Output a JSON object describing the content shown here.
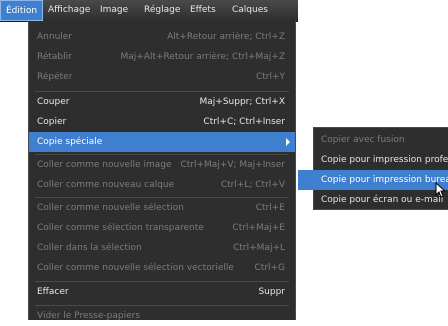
{
  "menubar": {
    "items": [
      "Édition",
      "Affichage",
      "Image",
      "Réglage",
      "Effets",
      "Calques"
    ]
  },
  "menu": {
    "items": [
      {
        "label": "Annuler",
        "shortcut": "Alt+Retour arrière; Ctrl+Z",
        "disabled": true
      },
      {
        "label": "Rétablir",
        "shortcut": "Maj+Alt+Retour arrière; Ctrl+Maj+Z",
        "disabled": true
      },
      {
        "label": "Répéter",
        "shortcut": "Ctrl+Y",
        "disabled": true
      },
      {
        "label": "Couper",
        "shortcut": "Maj+Suppr; Ctrl+X",
        "disabled": false
      },
      {
        "label": "Copier",
        "shortcut": "Ctrl+C; Ctrl+Inser",
        "disabled": false
      },
      {
        "label": "Copie spéciale",
        "shortcut": "",
        "disabled": false
      },
      {
        "label": "Coller comme nouvelle image",
        "shortcut": "Ctrl+Maj+V; Maj+Inser",
        "disabled": true
      },
      {
        "label": "Coller comme nouveau calque",
        "shortcut": "Ctrl+L; Ctrl+V",
        "disabled": true
      },
      {
        "label": "Coller comme nouvelle sélection",
        "shortcut": "Ctrl+E",
        "disabled": true
      },
      {
        "label": "Coller comme sélection transparente",
        "shortcut": "Ctrl+Maj+E",
        "disabled": true
      },
      {
        "label": "Coller dans la sélection",
        "shortcut": "Ctrl+Maj+L",
        "disabled": true
      },
      {
        "label": "Coller comme nouvelle sélection vectorielle",
        "shortcut": "Ctrl+G",
        "disabled": true
      },
      {
        "label": "Effacer",
        "shortcut": "Suppr",
        "disabled": false
      },
      {
        "label": "Vider le Presse-papiers",
        "shortcut": "",
        "disabled": true
      }
    ]
  },
  "submenu": {
    "items": [
      {
        "label": "Copier avec fusion",
        "disabled": true
      },
      {
        "label": "Copie pour impression professionnelle",
        "disabled": false
      },
      {
        "label": "Copie pour impression bureau",
        "disabled": false
      },
      {
        "label": "Copie pour écran ou e-mail",
        "disabled": false
      }
    ]
  },
  "colors": {
    "highlight": "#3f7fcf",
    "menu_bg": "#2e2e2e",
    "disabled_text": "#7c7c7c"
  }
}
